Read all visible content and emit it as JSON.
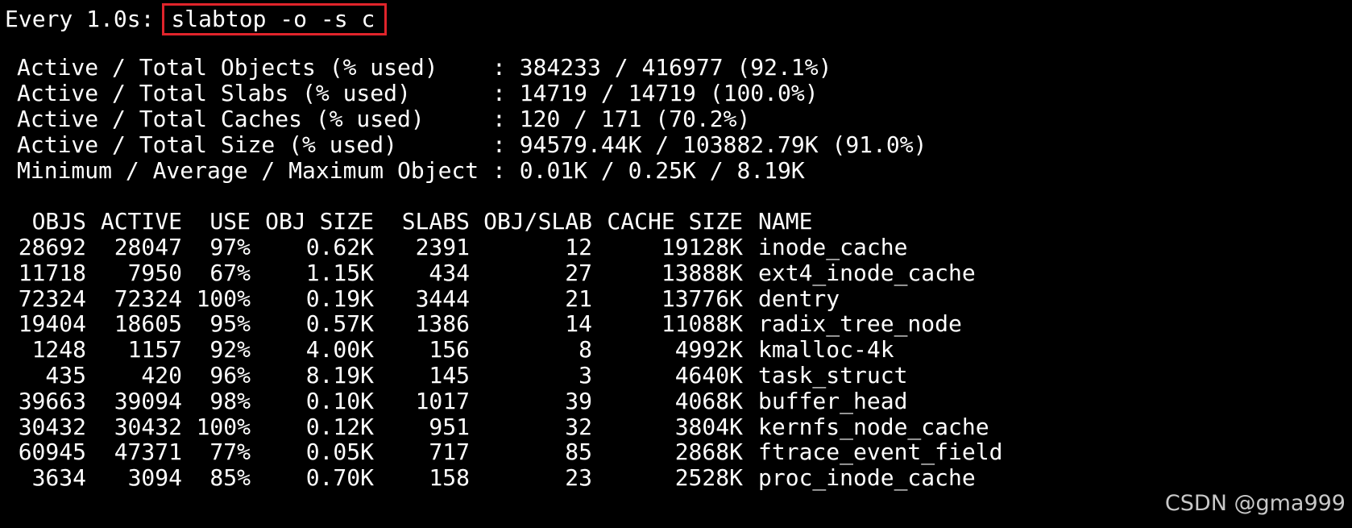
{
  "header": {
    "every_label": "Every 1.0s:",
    "command": "slabtop -o -s c"
  },
  "stats": [
    {
      "label": "Active / Total Objects (% used)    ",
      "value": "384233 / 416977 (92.1%)"
    },
    {
      "label": "Active / Total Slabs (% used)      ",
      "value": "14719 / 14719 (100.0%)"
    },
    {
      "label": "Active / Total Caches (% used)     ",
      "value": "120 / 171 (70.2%)"
    },
    {
      "label": "Active / Total Size (% used)       ",
      "value": "94579.44K / 103882.79K (91.0%)"
    },
    {
      "label": "Minimum / Average / Maximum Object ",
      "value": "0.01K / 0.25K / 8.19K"
    }
  ],
  "table": {
    "headers": [
      "OBJS",
      "ACTIVE",
      "USE",
      "OBJ SIZE",
      "SLABS",
      "OBJ/SLAB",
      "CACHE SIZE",
      "NAME"
    ],
    "rows": [
      [
        "28692",
        "28047",
        "97%",
        "0.62K",
        "2391",
        "12",
        "19128K",
        "inode_cache"
      ],
      [
        "11718",
        "7950",
        "67%",
        "1.15K",
        "434",
        "27",
        "13888K",
        "ext4_inode_cache"
      ],
      [
        "72324",
        "72324",
        "100%",
        "0.19K",
        "3444",
        "21",
        "13776K",
        "dentry"
      ],
      [
        "19404",
        "18605",
        "95%",
        "0.57K",
        "1386",
        "14",
        "11088K",
        "radix_tree_node"
      ],
      [
        "1248",
        "1157",
        "92%",
        "4.00K",
        "156",
        "8",
        "4992K",
        "kmalloc-4k"
      ],
      [
        "435",
        "420",
        "96%",
        "8.19K",
        "145",
        "3",
        "4640K",
        "task_struct"
      ],
      [
        "39663",
        "39094",
        "98%",
        "0.10K",
        "1017",
        "39",
        "4068K",
        "buffer_head"
      ],
      [
        "30432",
        "30432",
        "100%",
        "0.12K",
        "951",
        "32",
        "3804K",
        "kernfs_node_cache"
      ],
      [
        "60945",
        "47371",
        "77%",
        "0.05K",
        "717",
        "85",
        "2868K",
        "ftrace_event_field"
      ],
      [
        "3634",
        "3094",
        "85%",
        "0.70K",
        "158",
        "23",
        "2528K",
        "proc_inode_cache"
      ]
    ]
  },
  "watermark": "CSDN @gma999",
  "colors": {
    "background": "#000000",
    "text": "#ffffff",
    "highlight_box": "#e0242b"
  }
}
